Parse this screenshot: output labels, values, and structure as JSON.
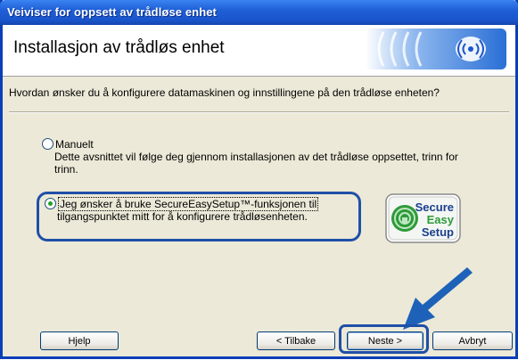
{
  "window": {
    "title": "Veiviser for oppsett av trådløse enhet"
  },
  "header": {
    "title": "Installasjon av trådløs enhet"
  },
  "question": "Hvordan ønsker du å konfigurere datamaskinen og innstillingene på den trådløse enheten?",
  "options": [
    {
      "label": "Manuelt",
      "selected": false,
      "description_line1": "Dette avsnittet vil følge deg gjennom installasjonen av det trådløse oppsettet, trinn for",
      "description_line2": "trinn."
    },
    {
      "label_line1": "Jeg ønsker å bruke SecureEasySetup™-funksjonen til",
      "label_line2": "tilgangspunktet mitt for å konfigurere trådløsenheten.",
      "selected": true
    }
  ],
  "badge": {
    "line1": "Secure",
    "line2": "Easy",
    "line3": "Setup"
  },
  "buttons": {
    "help": "Hjelp",
    "back": "< Tilbake",
    "next": "Neste >",
    "cancel": "Avbryt"
  },
  "colors": {
    "titlebar": "#1f5fd6",
    "highlight": "#1f4fa8",
    "badge_green": "#2e9a3a"
  },
  "icons": [
    "wireless-logo-icon",
    "secure-easy-setup-icon",
    "pointer-arrow-icon"
  ]
}
